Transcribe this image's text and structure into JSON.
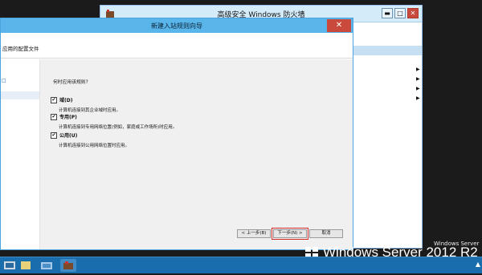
{
  "bg_window": {
    "title": "高级安全 Windows 防火墙",
    "controls": {
      "minimize": "▬",
      "maximize": "□",
      "close": "✕"
    },
    "action_arrows": [
      "▶",
      "▶",
      "▶",
      "▶"
    ]
  },
  "dialog": {
    "title": "新建入站规则向导",
    "close": "✕",
    "header": "应用的配置文件",
    "nav_item": "□",
    "question": "何时应用该规则?",
    "options": [
      {
        "label": "域(D)",
        "desc": "计算机连接到其企业域时应用。",
        "checked": true
      },
      {
        "label": "专用(P)",
        "desc": "计算机连接到专用网络位置(例如，家庭或工作场所)时应用。",
        "checked": true
      },
      {
        "label": "公用(U)",
        "desc": "计算机连接到公用网络位置时应用。",
        "checked": true
      }
    ],
    "buttons": {
      "back": "< 上一步(B)",
      "next": "下一步(N) >",
      "cancel": "取消"
    }
  },
  "branding": {
    "os_name": "Windows Server 2012 R2",
    "small_text": "Windows Server"
  },
  "taskbar": {
    "items": [
      "server-manager-icon",
      "powershell-icon",
      "file-explorer-icon",
      "firewall-icon"
    ]
  },
  "colors": {
    "dialog_title": "#59b5ea",
    "taskbar": "#1a6dac",
    "highlight": "#d42a2a"
  }
}
